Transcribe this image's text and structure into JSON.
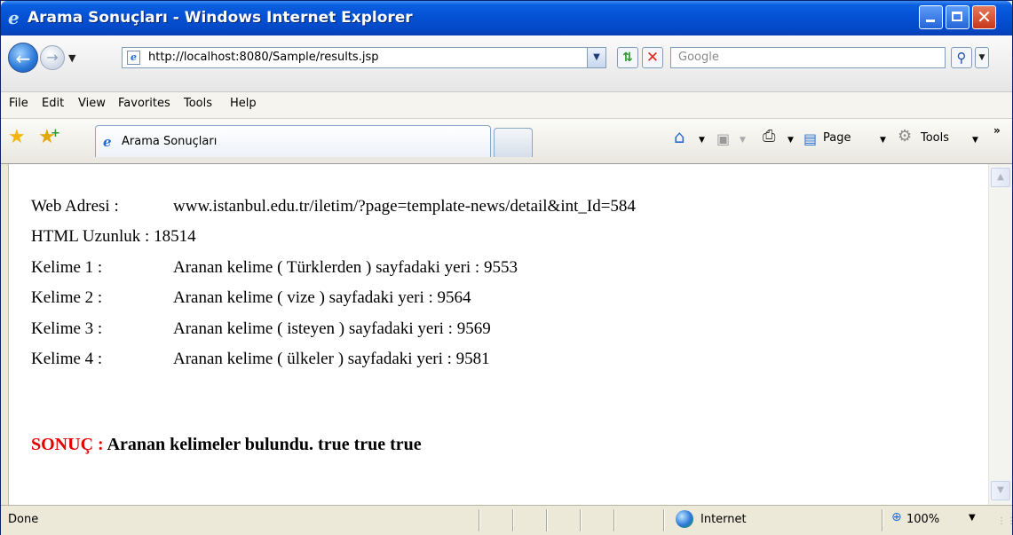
{
  "window": {
    "title": "Arama Sonuçları - Windows Internet Explorer",
    "minimize_icon": "minimize-icon",
    "maximize_icon": "maximize-icon",
    "close_glyph": "✕"
  },
  "addressbar": {
    "url": "http://localhost:8080/Sample/results.jsp",
    "search_placeholder": "Google"
  },
  "menu": {
    "items": [
      "File",
      "Edit",
      "View",
      "Favorites",
      "Tools",
      "Help"
    ]
  },
  "tabs": {
    "active_label": "Arama Sonuçları"
  },
  "commandbar": {
    "page_label": "Page",
    "tools_label": "Tools",
    "more_glyph": "»"
  },
  "content": {
    "rows": [
      {
        "label": "Web Adresi :",
        "value": "www.istanbul.edu.tr/iletim/?page=template-news/detail&int_Id=584"
      },
      {
        "label": "HTML Uzunluk : 18514",
        "value": ""
      },
      {
        "label": "Kelime 1 :",
        "value": "Aranan kelime ( Türklerden ) sayfadaki yeri : 9553"
      },
      {
        "label": "Kelime 2 :",
        "value": "Aranan kelime ( vize ) sayfadaki yeri : 9564"
      },
      {
        "label": "Kelime 3 :",
        "value": "Aranan kelime ( isteyen ) sayfadaki yeri : 9569"
      },
      {
        "label": "Kelime 4 :",
        "value": "Aranan kelime ( ülkeler ) sayfadaki yeri : 9581"
      }
    ],
    "result_label": "SONUÇ :",
    "result_text": "Aranan kelimeler bulundu. true true true",
    "colors": {
      "result_label": "#e60000"
    }
  },
  "statusbar": {
    "status": "Done",
    "zone": "Internet",
    "zoom": "100%"
  }
}
